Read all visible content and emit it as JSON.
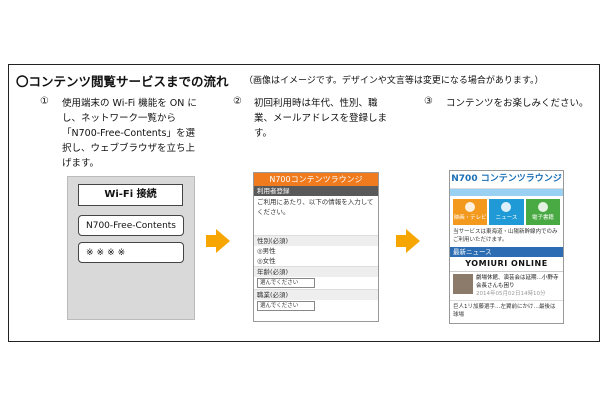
{
  "heading": {
    "title": "〇コンテンツ閲覧サービスまでの流れ",
    "note": "（画像はイメージです。デザインや文言等は変更になる場合があります。）"
  },
  "steps": [
    {
      "num": "①",
      "text": "使用端末の Wi-Fi 機能を ON にし、ネットワーク一覧から「N700-Free-Contents」を選択し、ウェブブラウザを立ち上げます。"
    },
    {
      "num": "②",
      "text": "初回利用時は年代、性別、職業、メールアドレスを登録します。"
    },
    {
      "num": "③",
      "text": "コンテンツをお楽しみください。"
    }
  ],
  "wifi_screen": {
    "title": "Wi-Fi 接続",
    "ssid": "N700-Free-Contents",
    "password": "※※※※"
  },
  "register_screen": {
    "header": "N700コンテンツラウンジ",
    "subheader": "利用者登録",
    "intro": "ご利用にあたり、以下の情報を入力してください。",
    "gender_label": "性別(必須)",
    "male": "◎男性",
    "female": "◎女性",
    "age_label": "年齢(必須)",
    "select_placeholder": "選んでください",
    "job_label": "職業(必須)",
    "job_select": "選んでください"
  },
  "lounge_screen": {
    "logo": "N700 コンテンツラウンジ",
    "tiles": [
      "映画・テレビ",
      "ニュース",
      "電子書籍"
    ],
    "notice": "当サービスは東海道・山陽新幹線内でのみご利用いただけます。",
    "news_header": "最新ニュース",
    "provider": "YOMIURI ONLINE",
    "item_title": "劇場休館、演芸会は延期…小野寺会長さんも困り",
    "item_date": "2014年05月02日14時10分",
    "bottom_line": "巨人1リ加藤選手…左翼前にかけ…最後は球場"
  },
  "colors": {
    "arrow": "#f7a600",
    "register_header": "#f07b1f",
    "lounge_blue": "#1b6fb5"
  }
}
